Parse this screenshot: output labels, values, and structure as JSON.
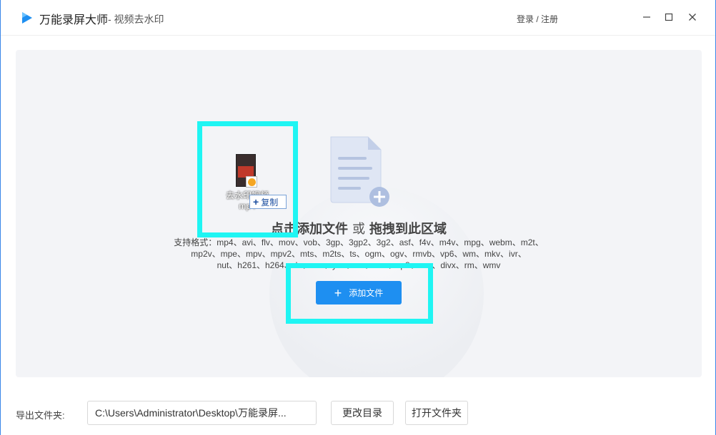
{
  "window": {
    "app_title": "万能录屏大师",
    "subtitle": "- 视频去水印",
    "login_label": "登录 / 注册",
    "accent_color": "#1e8ff1",
    "highlight_color": "#1ff5f3"
  },
  "dropzone": {
    "title_main": "点击添加文件",
    "title_or": "或",
    "title_drag": "拖拽到此区域",
    "formats_line1": "支持格式：mp4、avi、flv、mov、vob、3gp、3gp2、3g2、asf、f4v、m4v、mpg、webm、m2t、",
    "formats_line2": "mp2v、mpe、mpv、mpv2、mts、m2ts、ts、ogm、ogv、rmvb、vp6、wm、mkv、ivr、",
    "formats_line3": "nut、h261、h264、dv、avs、yuv、rm、ram、vp8、nsv、divx、rm、wmv",
    "add_button_label": "添加文件"
  },
  "drag": {
    "file_name_line1": "去水印视频",
    "file_name_line2": "mp4",
    "copy_label": "复制"
  },
  "bottom": {
    "export_label": "导出文件夹:",
    "export_path": "C:\\Users\\Administrator\\Desktop\\万能录屏...",
    "change_dir_label": "更改目录",
    "open_folder_label": "打开文件夹"
  }
}
